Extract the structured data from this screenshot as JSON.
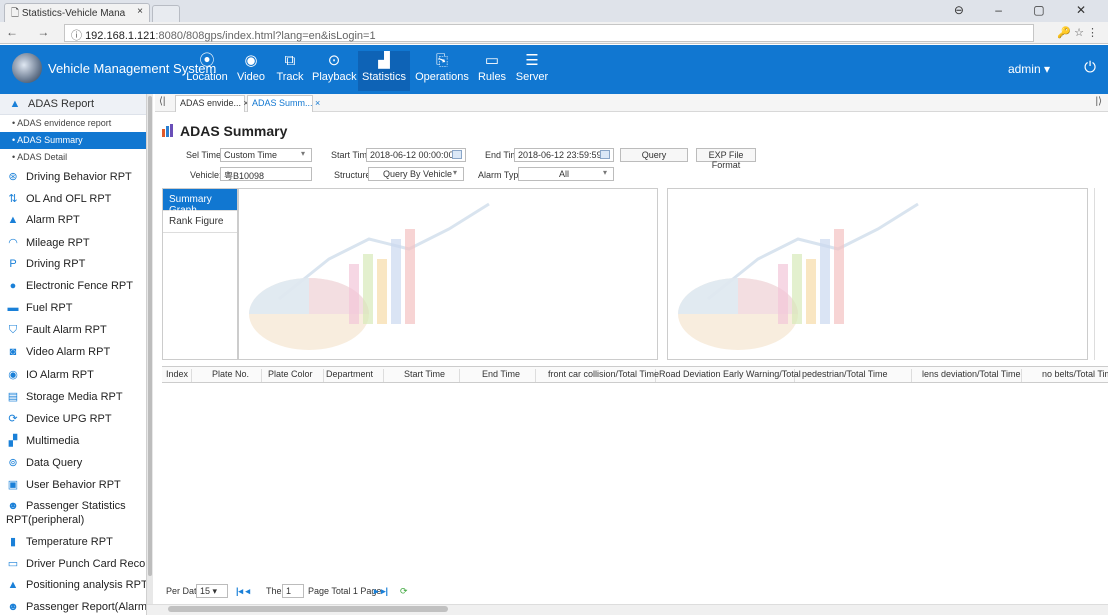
{
  "browser": {
    "tab_title": "Statistics-Vehicle Mana",
    "tab_close": "×",
    "url_host": "192.168.1.121",
    "url_rest": ":8080/808gps/index.html?lang=en&isLogin=1",
    "nav": "← → C",
    "window_controls": "⊖ – ▢ ✕"
  },
  "app": {
    "name": "Vehicle Management System",
    "user": "admin ▾",
    "nav": [
      {
        "label": "Location",
        "icon": "location-icon"
      },
      {
        "label": "Video",
        "icon": "video-icon"
      },
      {
        "label": "Track",
        "icon": "track-icon"
      },
      {
        "label": "Playback",
        "icon": "playback-icon"
      },
      {
        "label": "Statistics",
        "icon": "statistics-icon"
      },
      {
        "label": "Operations",
        "icon": "operations-icon"
      },
      {
        "label": "Rules",
        "icon": "rules-icon"
      },
      {
        "label": "Server",
        "icon": "server-icon"
      }
    ],
    "accent": "#1177d1"
  },
  "sidebar": {
    "section": "ADAS Report",
    "subitems": [
      "• ADAS envidence report",
      "• ADAS Summary",
      "• ADAS Detail"
    ],
    "items": [
      "Driving Behavior RPT",
      "OL And OFL RPT",
      "Alarm RPT",
      "Mileage RPT",
      "Driving RPT",
      "Electronic Fence RPT",
      "Fuel RPT",
      "Fault Alarm RPT",
      "Video Alarm RPT",
      "IO Alarm RPT",
      "Storage Media RPT",
      "Device UPG RPT",
      "Multimedia",
      "Data Query",
      "User Behavior RPT",
      "Passenger Statistics RPT(peripheral)",
      "Temperature RPT",
      "Driver Punch Card Records",
      "Positioning analysis RPT",
      "Passenger Report(Alarm)"
    ]
  },
  "page_tabs": [
    "ADAS envide...  ×",
    "ADAS Summ...  ×"
  ],
  "main": {
    "title": "ADAS Summary",
    "filters": {
      "sel_time_label": "Sel Time:",
      "sel_time_value": "Custom Time",
      "start_label": "Start Time:",
      "start_value": "2018-06-12 00:00:00",
      "end_label": "End Time:",
      "end_value": "2018-06-12 23:59:59",
      "query": "Query",
      "export": "EXP File Format",
      "vehicle_label": "Vehicle:",
      "vehicle_value": "粤B10098",
      "structure_label": "Structure:",
      "structure_value": "Query By Vehicle",
      "alarm_label": "Alarm Type:",
      "alarm_value": "All"
    },
    "graph_tabs": [
      "Summary Graph",
      "Rank Figure"
    ],
    "columns": [
      "Index",
      "Plate No.",
      "Plate Color",
      "Department",
      "Start Time",
      "End Time",
      "front car collision/Total Time",
      "Road Deviation Early Warning/Total",
      "pedestrian/Total Time",
      "lens deviation/Total Time",
      "no belts/Total Tim"
    ]
  },
  "pager": {
    "per_data": "Per Data",
    "per_value": "15",
    "the": "The",
    "page_value": "1",
    "page_total": "Page  Total 1 Page"
  }
}
